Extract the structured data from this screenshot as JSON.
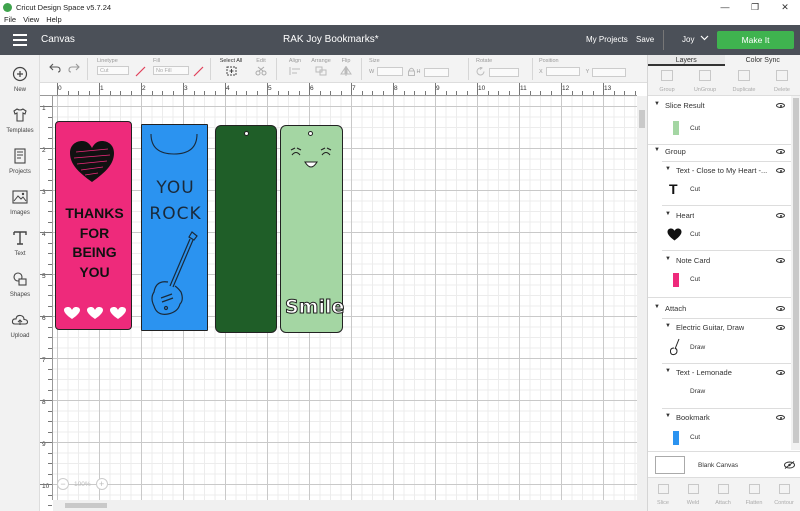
{
  "window": {
    "title": "Cricut Design Space   v5.7.24",
    "controls": [
      "—",
      "❐",
      "✕"
    ]
  },
  "menubar": {
    "items": [
      "File",
      "View",
      "Help"
    ]
  },
  "header": {
    "section": "Canvas",
    "project_title": "RAK Joy Bookmarks*",
    "my_projects": "My Projects",
    "save": "Save",
    "user": "Joy",
    "make_it": "Make It",
    "colors": {
      "bar": "#4b5058",
      "make_it": "#3fb34f"
    }
  },
  "sidebar": {
    "items": [
      {
        "label": "New",
        "icon": "plus-circle-icon"
      },
      {
        "label": "Templates",
        "icon": "shirt-icon"
      },
      {
        "label": "Projects",
        "icon": "projects-grid-icon"
      },
      {
        "label": "Images",
        "icon": "image-icon"
      },
      {
        "label": "Text",
        "icon": "text-t-icon"
      },
      {
        "label": "Shapes",
        "icon": "shapes-icon"
      },
      {
        "label": "Upload",
        "icon": "cloud-upload-icon"
      }
    ]
  },
  "toolbar": {
    "linetype": {
      "label": "Linetype",
      "value": "Cut"
    },
    "fill": {
      "label": "Fill",
      "value": "No Fill"
    },
    "select_all": "Select All",
    "edit": "Edit",
    "align": "Align",
    "arrange": "Arrange",
    "flip": "Flip",
    "size": {
      "label": "Size",
      "w": "W",
      "h": "H"
    },
    "rotate": "Rotate",
    "position": {
      "label": "Position",
      "x": "X",
      "y": "Y"
    }
  },
  "rulers": {
    "top": [
      "0",
      "1",
      "2",
      "3",
      "4",
      "5",
      "6",
      "7",
      "8",
      "9",
      "10",
      "11",
      "12",
      "13"
    ],
    "left": [
      "1",
      "2",
      "3",
      "4",
      "5",
      "6",
      "7",
      "8",
      "9",
      "10"
    ]
  },
  "canvas": {
    "bookmarks": [
      {
        "name": "thanks",
        "lines": [
          "THANKS",
          "FOR",
          "BEING",
          "YOU"
        ],
        "color": "#ee2a7b"
      },
      {
        "name": "you-rock",
        "lines": [
          "YOU",
          "ROCK"
        ],
        "color": "#2b93f0"
      },
      {
        "name": "dark-green",
        "color": "#1f5e28"
      },
      {
        "name": "smile",
        "text": "Smile",
        "color": "#a4d6a3"
      }
    ],
    "zoom": "100%"
  },
  "panel": {
    "tabs": [
      "Layers",
      "Color Sync"
    ],
    "actions": [
      "Group",
      "UnGroup",
      "Duplicate",
      "Delete"
    ],
    "layers": [
      {
        "type": "group",
        "name": "Slice Result"
      },
      {
        "type": "leaf",
        "op": "Cut",
        "color": "#a4d6a3"
      },
      {
        "type": "group",
        "name": "Group"
      },
      {
        "type": "sub",
        "name": "Text - Close to My Heart -...",
        "op": "Cut"
      },
      {
        "type": "sub",
        "name": "Heart",
        "op": "Cut"
      },
      {
        "type": "sub",
        "name": "Note Card",
        "op": "Cut",
        "color": "#ee2a7b"
      },
      {
        "type": "group",
        "name": "Attach"
      },
      {
        "type": "sub",
        "name": "Electric Guitar, Draw",
        "op": "Draw"
      },
      {
        "type": "sub",
        "name": "Text - Lemonade",
        "op": "Draw"
      },
      {
        "type": "sub",
        "name": "Bookmark",
        "op": "Cut",
        "color": "#2b93f0"
      }
    ],
    "blank_canvas": "Blank Canvas",
    "bottom_actions": [
      "Slice",
      "Weld",
      "Attach",
      "Flatten",
      "Contour"
    ]
  }
}
